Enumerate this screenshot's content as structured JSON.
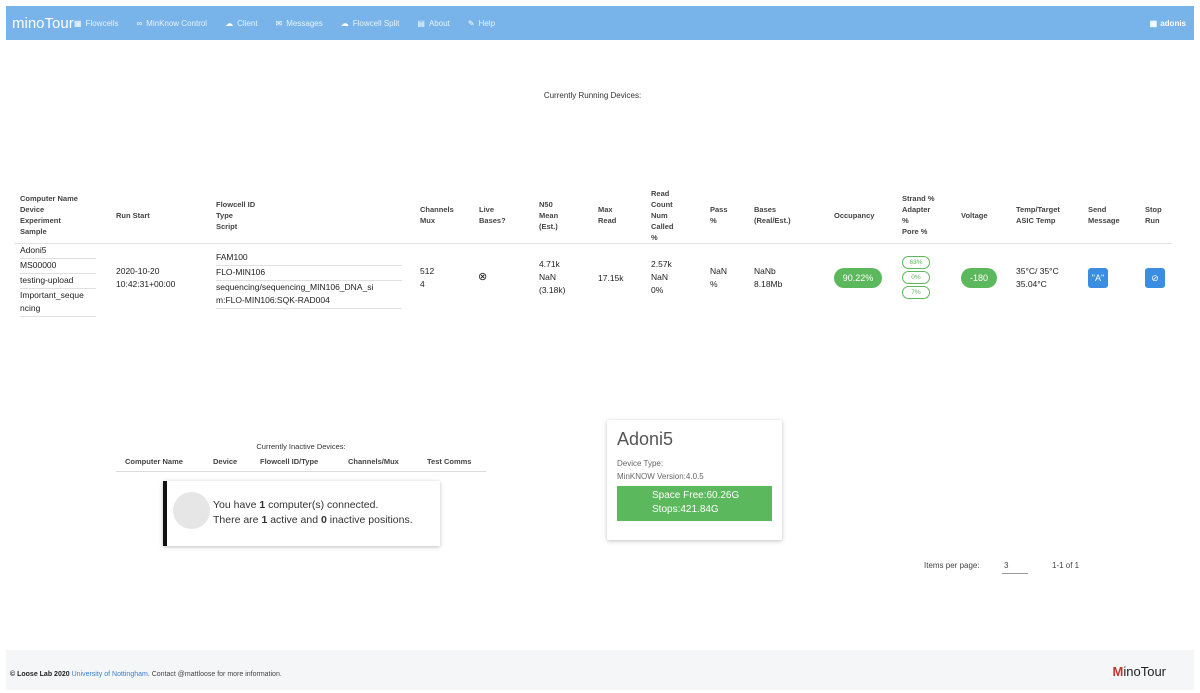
{
  "navbar": {
    "brand": "minoTour",
    "items": [
      {
        "icon": "grid-icon",
        "label": "Flowcells"
      },
      {
        "icon": "link-icon",
        "label": "MinKnow Control"
      },
      {
        "icon": "cloud-icon",
        "label": "Client"
      },
      {
        "icon": "mail-icon",
        "label": "Messages"
      },
      {
        "icon": "cloud-icon",
        "label": "Flowcell Split"
      },
      {
        "icon": "book-icon",
        "label": "About"
      },
      {
        "icon": "help-icon",
        "label": "Help"
      }
    ],
    "user": "adonis"
  },
  "running": {
    "title": "Currently Running Devices:",
    "headers": {
      "computer": [
        "Computer Name",
        "Device",
        "Experiment",
        "Sample"
      ],
      "run_start": [
        "Run Start"
      ],
      "flowcell": [
        "Flowcell ID",
        "Type",
        "Script"
      ],
      "channels": [
        "Channels",
        "Mux"
      ],
      "live": [
        "Live",
        "Bases?"
      ],
      "n50": [
        "N50",
        "Mean",
        "(Est.)"
      ],
      "max_read": [
        "Max",
        "Read"
      ],
      "read_count": [
        "Read",
        "Count",
        "Num",
        "Called",
        "%"
      ],
      "pass": [
        "Pass",
        "%"
      ],
      "bases": [
        "Bases",
        "(Real/Est.)"
      ],
      "occupancy": [
        "Occupancy"
      ],
      "strand": [
        "Strand %",
        "Adapter",
        "%",
        "Pore %"
      ],
      "voltage": [
        "Voltage"
      ],
      "temp": [
        "Temp/Target",
        "ASIC Temp"
      ],
      "send": [
        "Send",
        "Message"
      ],
      "stop": [
        "Stop",
        "Run"
      ]
    },
    "row": {
      "computer": [
        "Adoni5",
        "MS00000",
        "testing-upload",
        "Important_seque",
        "ncing"
      ],
      "run_start": [
        "2020-10-20",
        "10:42:31+00:00"
      ],
      "flowcell": [
        "FAM100",
        "FLO-MIN106",
        "sequencing/sequencing_MIN106_DNA_si",
        "m:FLO-MIN106:SQK-RAD004"
      ],
      "channels": [
        "512",
        "4"
      ],
      "live_icon": "⊗",
      "n50": [
        "4.71k",
        "NaN",
        "(3.18k)"
      ],
      "max_read": "17.15k",
      "read_count": [
        "2.57k",
        "NaN",
        "0%"
      ],
      "pass": [
        "NaN",
        "%"
      ],
      "bases": [
        "NaNb",
        "8.18Mb"
      ],
      "occupancy": "90.22%",
      "strand": [
        "63%",
        "0%",
        "7%"
      ],
      "voltage": "-180",
      "temp": [
        "35°C/ 35°C",
        "35.04°C"
      ],
      "send_icon": "\"A\"",
      "stop_icon": "⊘"
    }
  },
  "inactive": {
    "title": "Currently Inactive Devices:",
    "headers": [
      "Computer Name",
      "Device",
      "Flowcell ID/Type",
      "Channels/Mux",
      "Test Comms"
    ]
  },
  "summary": {
    "line1_pre": "You have ",
    "line1_num": "1",
    "line1_post": " computer(s) connected.",
    "line2_a": "There are ",
    "line2_num1": "1",
    "line2_b": " active and ",
    "line2_num2": "0",
    "line2_c": " inactive positions."
  },
  "device_card": {
    "name": "Adoni5",
    "device_type": "Device Type:",
    "minknow_version": "MinKNOW Version:4.0.5",
    "space_free": "Space Free:60.26G",
    "stops": "Stops:421.84G"
  },
  "pagination": {
    "label": "Items per page:",
    "value": "3",
    "range": "1-1 of 1"
  },
  "footer": {
    "copyright": "© Loose Lab 2020",
    "university": "University of Nottingham",
    "contact": ". Contact @mattloose for more information.",
    "logo": "inoTour",
    "logo_mark": "M"
  },
  "colors": {
    "navbar": "#78b4ea",
    "success": "#5cb85c",
    "primary_button": "#3a8de0"
  }
}
